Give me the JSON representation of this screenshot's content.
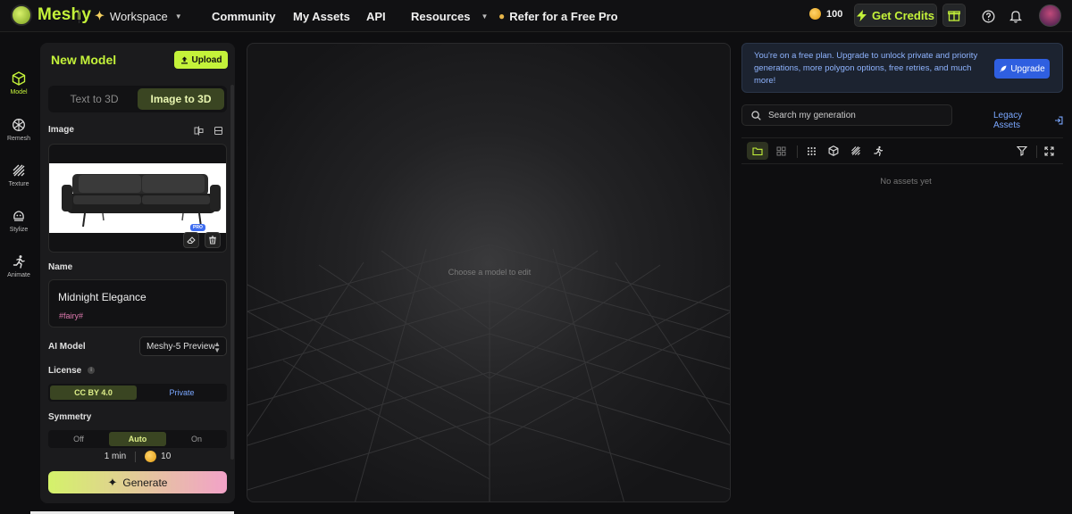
{
  "brand": {
    "name": "Meshy",
    "accent": "#c4f23a"
  },
  "topnav": {
    "workspace": "Workspace",
    "community": "Community",
    "my_assets": "My Assets",
    "api": "API",
    "resources": "Resources",
    "refer": "Refer for a Free Pro",
    "credits": "100",
    "get_credits": "Get Credits"
  },
  "leftnav": {
    "items": [
      {
        "label": "Model",
        "icon": "cube-icon",
        "active": true
      },
      {
        "label": "Remesh",
        "icon": "mesh-icon",
        "active": false
      },
      {
        "label": "Texture",
        "icon": "texture-icon",
        "active": false
      },
      {
        "label": "Stylize",
        "icon": "stylize-icon",
        "active": false
      },
      {
        "label": "Animate",
        "icon": "running-figure-icon",
        "active": false
      }
    ]
  },
  "panel": {
    "title": "New Model",
    "upload": "Upload",
    "tabs": [
      "Text to 3D",
      "Image to 3D"
    ],
    "active_tab": "Image to 3D",
    "image_label": "Image",
    "pro_badge": "PRO",
    "name_label": "Name",
    "name_value": "Midnight Elegance",
    "name_tag": "#fairy#",
    "ai_model_label": "AI Model",
    "ai_model_value": "Meshy-5 Preview",
    "license_label": "License",
    "license_options": [
      "CC BY 4.0",
      "Private"
    ],
    "license_selected": "CC BY 4.0",
    "symmetry_label": "Symmetry",
    "symmetry_options": [
      "Off",
      "Auto",
      "On"
    ],
    "symmetry_selected": "Auto",
    "time": "1 min",
    "cost": "10",
    "generate": "Generate"
  },
  "viewport": {
    "hint": "Choose a model to edit"
  },
  "right": {
    "plan_text": "You're on a free plan. Upgrade to unlock private and priority generations, more polygon options, free retries, and much more!",
    "upgrade": "Upgrade",
    "search_placeholder": "Search my generation",
    "legacy": "Legacy Assets",
    "empty": "No assets yet"
  }
}
